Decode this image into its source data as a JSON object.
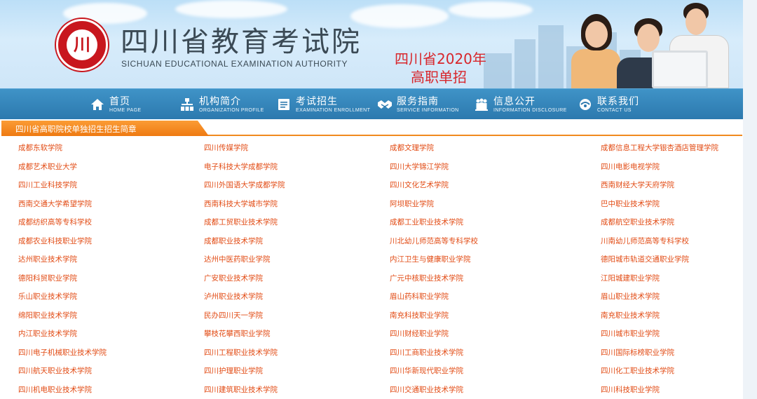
{
  "header": {
    "org_name_cn": "四川省教育考试院",
    "org_name_en": "SICHUAN EDUCATIONAL EXAMINATION AUTHORITY",
    "promo_line1": "四川省2020年",
    "promo_line2": "高职单招",
    "logo_glyph": "川"
  },
  "nav": [
    {
      "cn": "首页",
      "en": "HOME PAGE",
      "icon": "home-icon"
    },
    {
      "cn": "机构简介",
      "en": "ORGANIZATION PROFILE",
      "icon": "organization-icon"
    },
    {
      "cn": "考试招生",
      "en": "EXAMINATION ENROLLMENT",
      "icon": "document-icon"
    },
    {
      "cn": "服务指南",
      "en": "SERVICE INFORMATION",
      "icon": "handshake-icon"
    },
    {
      "cn": "信息公开",
      "en": "INFORMATION DISCLOSURE",
      "icon": "people-icon"
    },
    {
      "cn": "联系我们",
      "en": "CONTACT US",
      "icon": "contact-icon"
    }
  ],
  "section": {
    "title": "四川省高职院校单独招生招生简章"
  },
  "colors": {
    "accent_orange": "#ee7a12",
    "nav_blue": "#2c79ae",
    "link_orange": "#e24b14",
    "logo_red": "#c8171e"
  },
  "schools": [
    [
      "成都东软学院",
      "四川传媒学院",
      "成都文理学院",
      "成都信息工程大学银杏酒店管理学院"
    ],
    [
      "成都艺术职业大学",
      "电子科技大学成都学院",
      "四川大学锦江学院",
      "四川电影电视学院"
    ],
    [
      "四川工业科技学院",
      "四川外国语大学成都学院",
      "四川文化艺术学院",
      "西南财经大学天府学院"
    ],
    [
      "西南交通大学希望学院",
      "西南科技大学城市学院",
      "阿坝职业学院",
      "巴中职业技术学院"
    ],
    [
      "成都纺织高等专科学校",
      "成都工贸职业技术学院",
      "成都工业职业技术学院",
      "成都航空职业技术学院"
    ],
    [
      "成都农业科技职业学院",
      "成都职业技术学院",
      "川北幼儿师范高等专科学校",
      "川南幼儿师范高等专科学校"
    ],
    [
      "达州职业技术学院",
      "达州中医药职业学院",
      "内江卫生与健康职业学院",
      "德阳城市轨道交通职业学院"
    ],
    [
      "德阳科贸职业学院",
      "广安职业技术学院",
      "广元中核职业技术学院",
      "江阳城建职业学院"
    ],
    [
      "乐山职业技术学院",
      "泸州职业技术学院",
      "眉山药科职业学院",
      "眉山职业技术学院"
    ],
    [
      "绵阳职业技术学院",
      "民办四川天一学院",
      "南充科技职业学院",
      "南充职业技术学院"
    ],
    [
      "内江职业技术学院",
      "攀枝花攀西职业学院",
      "四川财经职业学院",
      "四川城市职业学院"
    ],
    [
      "四川电子机械职业技术学院",
      "四川工程职业技术学院",
      "四川工商职业技术学院",
      "四川国际标榜职业学院"
    ],
    [
      "四川航天职业技术学院",
      "四川护理职业学院",
      "四川华新现代职业学院",
      "四川化工职业技术学院"
    ],
    [
      "四川机电职业技术学院",
      "四川建筑职业技术学院",
      "四川交通职业技术学院",
      "四川科技职业学院"
    ]
  ]
}
